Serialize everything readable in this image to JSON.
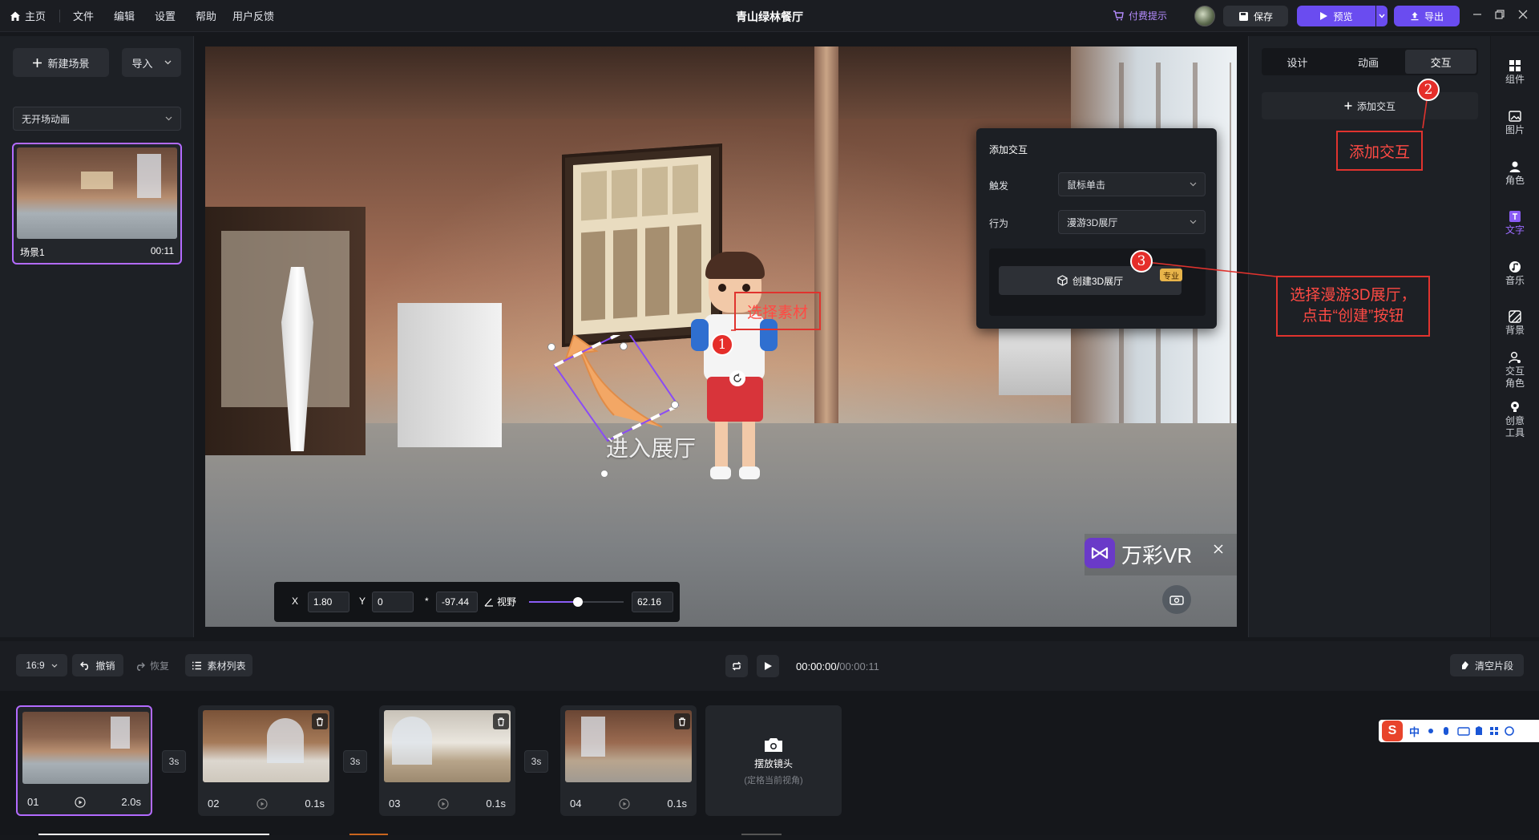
{
  "menu": {
    "home": "主页",
    "file": "文件",
    "edit": "编辑",
    "settings": "设置",
    "help": "帮助",
    "feedback": "用户反馈"
  },
  "title": "青山绿林餐厅",
  "header": {
    "pay_hint": "付费提示",
    "save": "保存",
    "preview": "预览",
    "export": "导出"
  },
  "left": {
    "new_scene": "新建场景",
    "import": "导入",
    "scene_anim": "无开场动画",
    "scene_name": "场景1",
    "scene_time": "00:11"
  },
  "canvas": {
    "hotspot_text": "进入展厅",
    "brand": "万彩VR",
    "coords": {
      "x_label": "X",
      "x_val": "1.80",
      "y_label": "Y",
      "y_val": "0",
      "z_label": "*",
      "z_val": "-97.44",
      "fov_label": "视野",
      "fov_val": "62.16",
      "fov_fraction": 0.52
    }
  },
  "popup": {
    "title": "添加交互",
    "trigger_label": "触发",
    "trigger_value": "鼠标单击",
    "action_label": "行为",
    "action_value": "漫游3D展厅",
    "create_btn": "创建3D展厅",
    "pro_tag": "专业"
  },
  "callouts": {
    "c1": "选择素材",
    "n1": "1",
    "c2": "添加交互",
    "n2": "2",
    "c3_line1": "选择漫游3D展厅，",
    "c3_line2": "点击“创建”按钮",
    "n3": "3"
  },
  "right": {
    "tabs": [
      "设计",
      "动画",
      "交互"
    ],
    "add_interaction": "添加交互"
  },
  "rail": [
    {
      "label": "组件",
      "icon": "grid-icon"
    },
    {
      "label": "图片",
      "icon": "image-icon"
    },
    {
      "label": "角色",
      "icon": "person-icon"
    },
    {
      "label": "文字",
      "icon": "text-icon"
    },
    {
      "label": "音乐",
      "icon": "music-icon"
    },
    {
      "label": "背景",
      "icon": "background-icon"
    },
    {
      "label": "交互",
      "label2": "角色",
      "icon": "interactive-person-icon"
    },
    {
      "label": "创意",
      "label2": "工具",
      "icon": "bulb-icon"
    }
  ],
  "toolbar": {
    "ratio": "16:9",
    "undo": "撤销",
    "redo": "恢复",
    "assets": "素材列表",
    "time_current": "00:00:00/",
    "time_total": "00:00:11",
    "clear": "清空片段"
  },
  "clips": [
    {
      "id": "01",
      "dur": "2.0s"
    },
    {
      "id": "02",
      "dur": "0.1s"
    },
    {
      "id": "03",
      "dur": "0.1s"
    },
    {
      "id": "04",
      "dur": "0.1s"
    }
  ],
  "transitions": [
    "3s",
    "3s",
    "3s"
  ],
  "camera": {
    "title": "摆放镜头",
    "subtitle": "(定格当前视角)"
  },
  "ime": {
    "label": "中"
  },
  "colors": {
    "accent": "#7b5cf0",
    "highlight": "#b36bff",
    "callout": "#e0332e",
    "export": "#6b4df0"
  }
}
